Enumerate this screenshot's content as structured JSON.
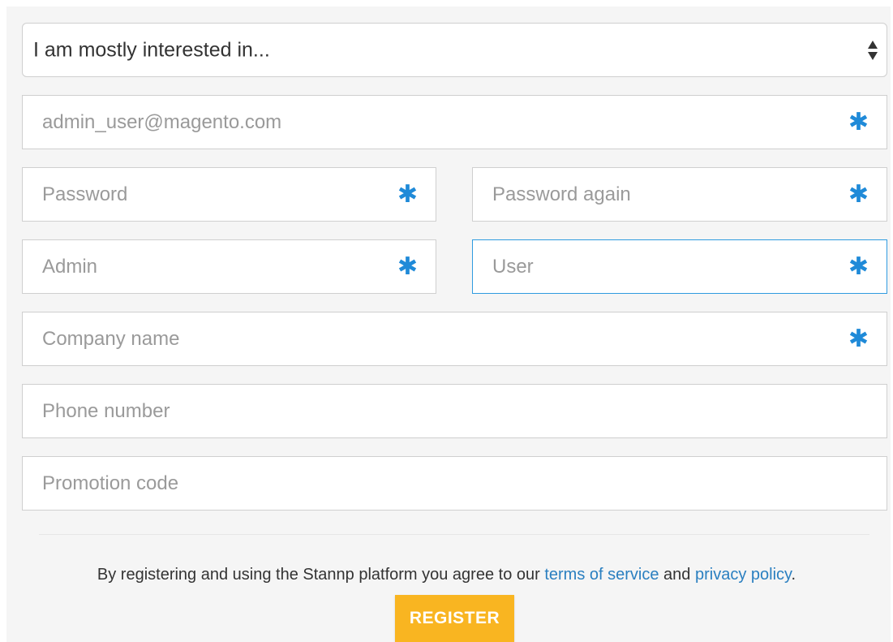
{
  "form": {
    "interest_select": {
      "value": "I am mostly interested in..."
    },
    "email": {
      "placeholder": "admin_user@magento.com"
    },
    "password": {
      "placeholder": "Password"
    },
    "password_again": {
      "placeholder": "Password again"
    },
    "first_name": {
      "placeholder": "Admin"
    },
    "last_name": {
      "placeholder": "User"
    },
    "company": {
      "placeholder": "Company name"
    },
    "phone": {
      "placeholder": "Phone number"
    },
    "promo": {
      "placeholder": "Promotion code"
    },
    "required_marker": "✱"
  },
  "terms": {
    "prefix": "By registering and using the Stannp platform you agree to our ",
    "terms_link": "terms of service",
    "middle": " and ",
    "privacy_link": "privacy policy",
    "suffix": "."
  },
  "register_button": {
    "label": "REGISTER"
  },
  "colors": {
    "accent_blue": "#1f8ad8",
    "focus_border": "#2f9be0",
    "button_yellow": "#f9b521",
    "link": "#2a7fc0"
  }
}
